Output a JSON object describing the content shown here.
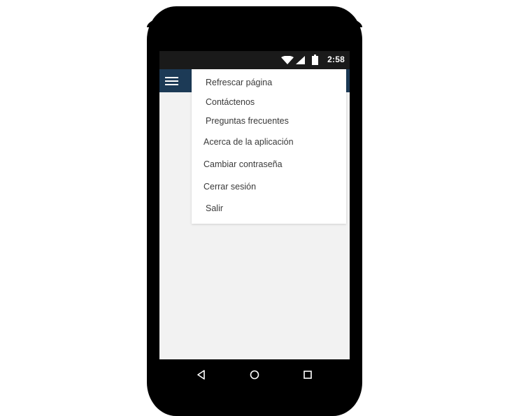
{
  "status_bar": {
    "time": "2:58",
    "icons": [
      "wifi-icon",
      "signal-icon",
      "battery-icon"
    ]
  },
  "app_bar": {
    "menu_icon": "hamburger-menu-icon",
    "color": "#1c3a56"
  },
  "dropdown_menu": {
    "items": [
      {
        "label": "Refrescar página"
      },
      {
        "label": "Contáctenos"
      },
      {
        "label": "Preguntas frecuentes"
      },
      {
        "label": "Acerca de la aplicación"
      },
      {
        "label": "Cambiar contraseña"
      },
      {
        "label": "Cerrar sesión"
      },
      {
        "label": "Salir"
      }
    ]
  },
  "navigation_bar": {
    "buttons": [
      "back-icon",
      "home-icon",
      "recents-icon"
    ]
  },
  "colors": {
    "screen_background": "#f2f2f2",
    "status_bar": "#1a1a1a",
    "menu_text": "#3a3a3a"
  }
}
